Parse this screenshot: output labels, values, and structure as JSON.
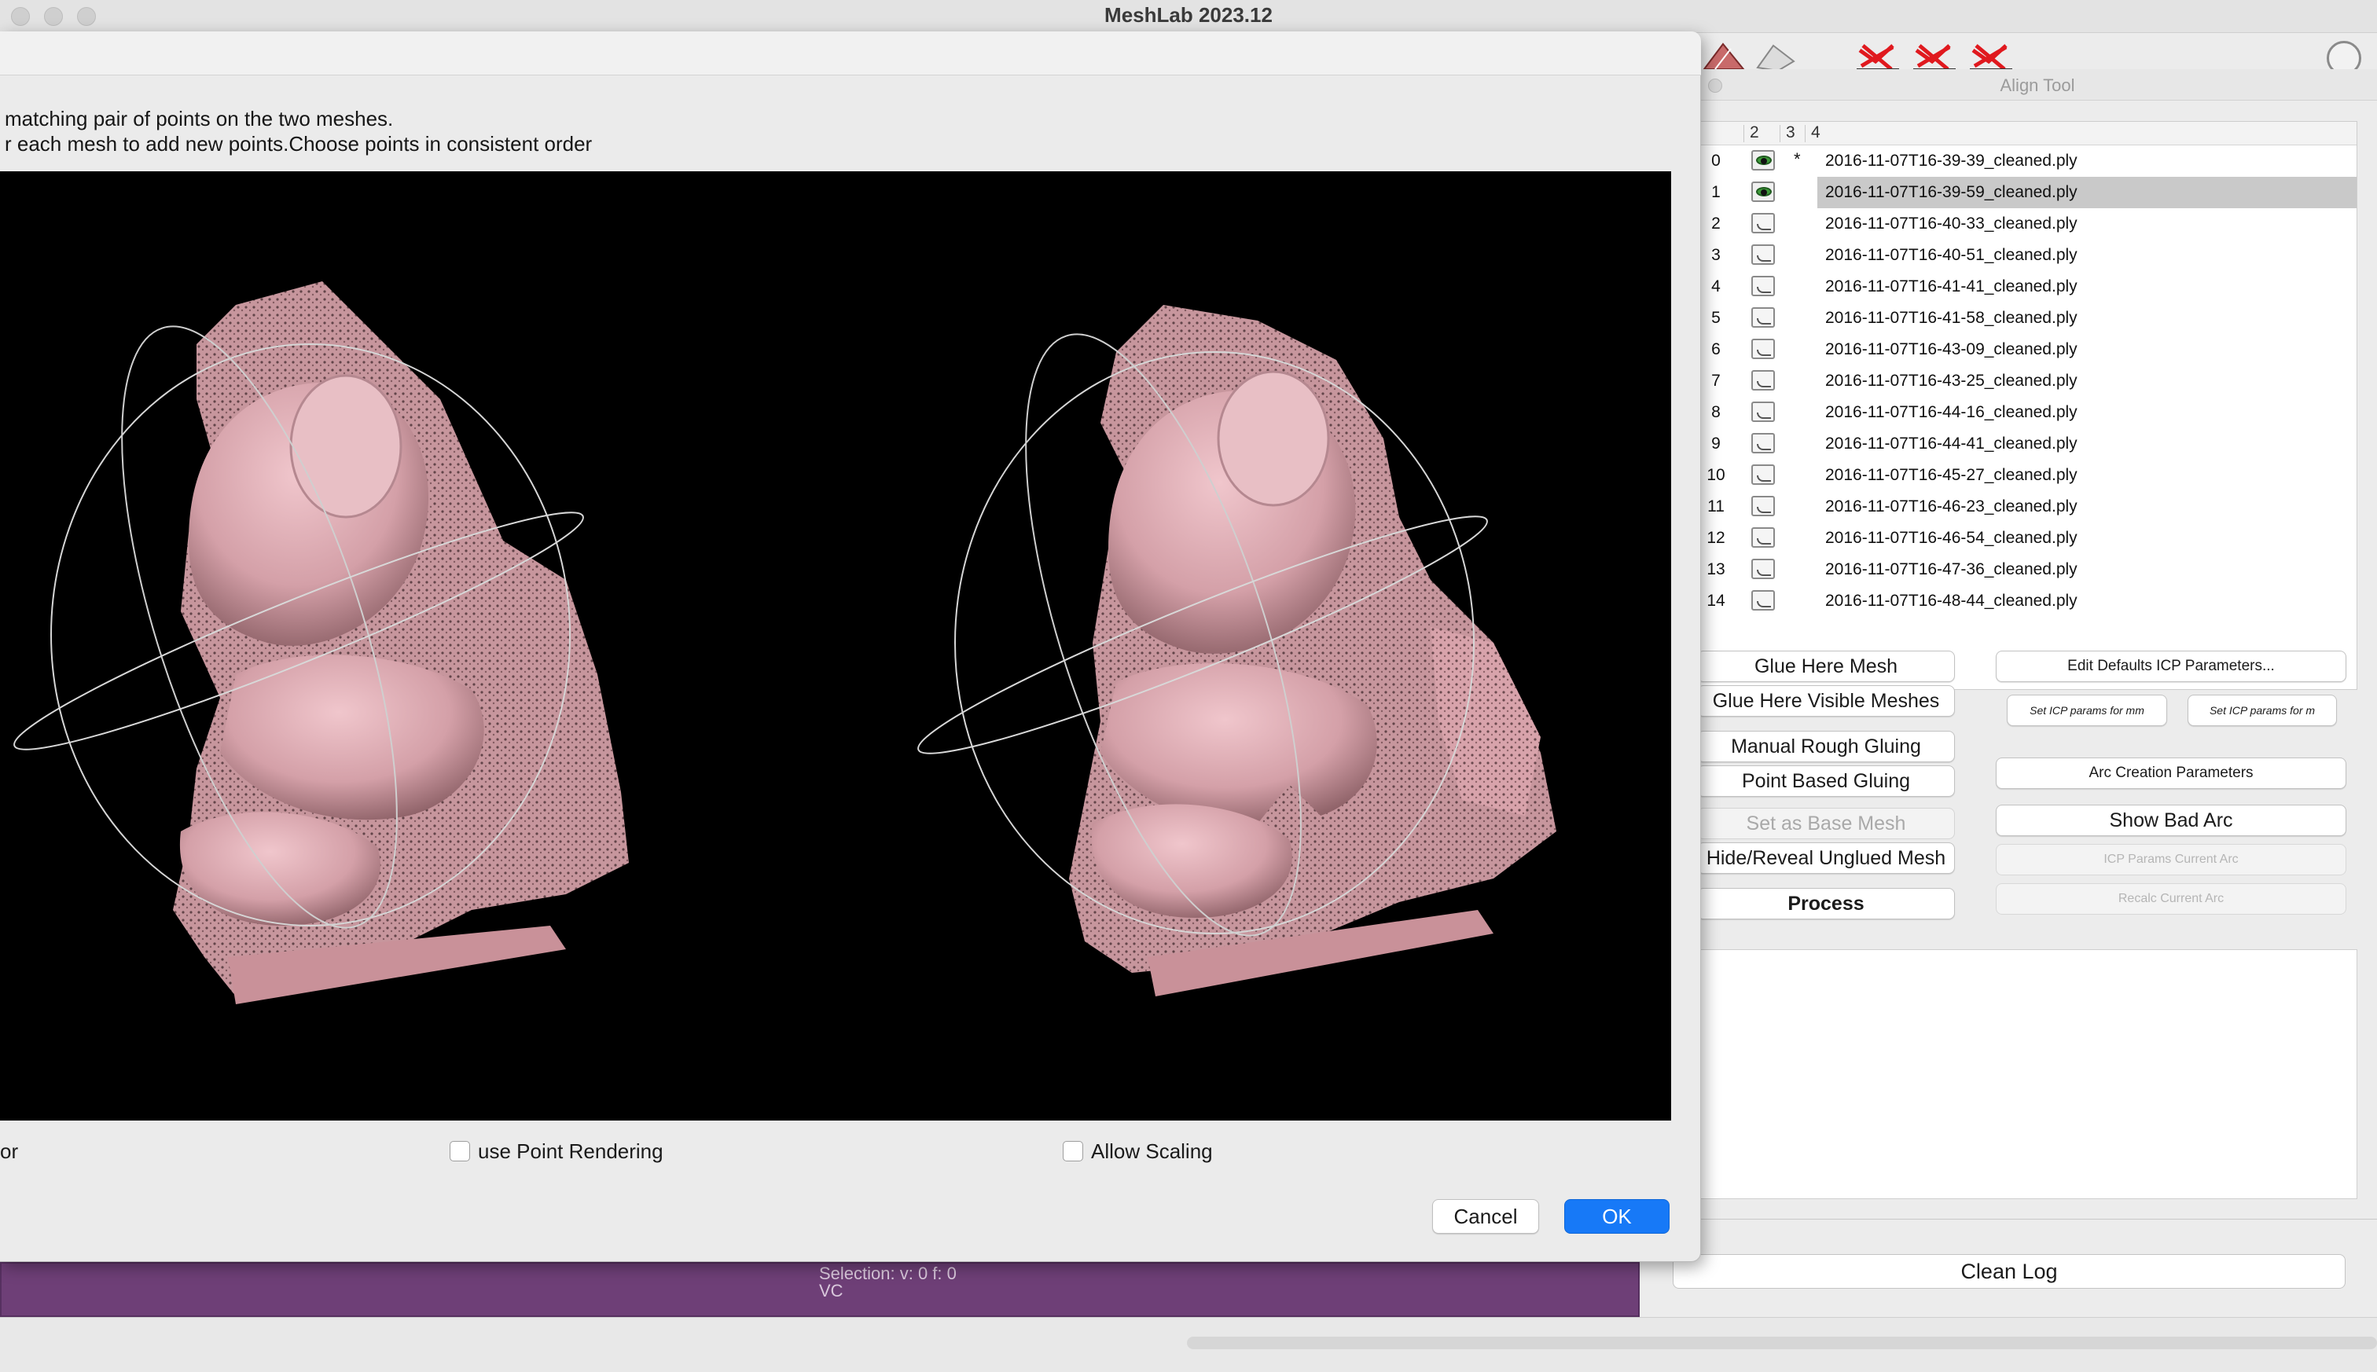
{
  "app": {
    "title": "MeshLab 2023.12"
  },
  "dialog": {
    "instructions": [
      " matching pair of points on the two meshes.",
      "r each mesh to add new points.Choose points in consistent order"
    ],
    "options": {
      "partial_label": "or",
      "point_rendering_label": "use Point Rendering",
      "allow_scaling_label": "Allow Scaling"
    },
    "cancel_label": "Cancel",
    "ok_label": "OK"
  },
  "align_tool": {
    "title": "Align Tool",
    "columns": [
      "2",
      "3",
      "4"
    ],
    "meshes": [
      {
        "id": "0",
        "visible": true,
        "base": "*",
        "name": "2016-11-07T16-39-39_cleaned.ply",
        "selected": false
      },
      {
        "id": "1",
        "visible": true,
        "base": "",
        "name": "2016-11-07T16-39-59_cleaned.ply",
        "selected": true
      },
      {
        "id": "2",
        "visible": false,
        "base": "",
        "name": "2016-11-07T16-40-33_cleaned.ply",
        "selected": false
      },
      {
        "id": "3",
        "visible": false,
        "base": "",
        "name": "2016-11-07T16-40-51_cleaned.ply",
        "selected": false
      },
      {
        "id": "4",
        "visible": false,
        "base": "",
        "name": "2016-11-07T16-41-41_cleaned.ply",
        "selected": false
      },
      {
        "id": "5",
        "visible": false,
        "base": "",
        "name": "2016-11-07T16-41-58_cleaned.ply",
        "selected": false
      },
      {
        "id": "6",
        "visible": false,
        "base": "",
        "name": "2016-11-07T16-43-09_cleaned.ply",
        "selected": false
      },
      {
        "id": "7",
        "visible": false,
        "base": "",
        "name": "2016-11-07T16-43-25_cleaned.ply",
        "selected": false
      },
      {
        "id": "8",
        "visible": false,
        "base": "",
        "name": "2016-11-07T16-44-16_cleaned.ply",
        "selected": false
      },
      {
        "id": "9",
        "visible": false,
        "base": "",
        "name": "2016-11-07T16-44-41_cleaned.ply",
        "selected": false
      },
      {
        "id": "10",
        "visible": false,
        "base": "",
        "name": "2016-11-07T16-45-27_cleaned.ply",
        "selected": false
      },
      {
        "id": "11",
        "visible": false,
        "base": "",
        "name": "2016-11-07T16-46-23_cleaned.ply",
        "selected": false
      },
      {
        "id": "12",
        "visible": false,
        "base": "",
        "name": "2016-11-07T16-46-54_cleaned.ply",
        "selected": false
      },
      {
        "id": "13",
        "visible": false,
        "base": "",
        "name": "2016-11-07T16-47-36_cleaned.ply",
        "selected": false
      },
      {
        "id": "14",
        "visible": false,
        "base": "",
        "name": "2016-11-07T16-48-44_cleaned.ply",
        "selected": false
      }
    ],
    "buttons": {
      "glue_here_mesh": "Glue Here Mesh",
      "glue_here_visible": "Glue Here Visible Meshes",
      "manual_rough_gluing": "Manual Rough Gluing",
      "point_based_gluing": "Point Based Gluing",
      "set_as_base_mesh": "Set as Base Mesh",
      "hide_reveal_unglued": "Hide/Reveal Unglued Mesh",
      "process": "Process",
      "edit_defaults_icp": "Edit Defaults ICP Parameters...",
      "set_icp_mm": "Set ICP params for mm",
      "set_icp_m": "Set ICP params for m",
      "arc_creation_params": "Arc Creation Parameters",
      "show_bad_arc": "Show Bad Arc",
      "icp_params_current_arc": "ICP Params Current Arc",
      "recalc_current_arc": "Recalc Current Arc"
    },
    "clean_log": "Clean Log"
  },
  "status": {
    "selection": "Selection: v: 0 f: 0",
    "vc": "VC"
  },
  "colors": {
    "mesh_pink": "#d9a6ae",
    "ok_blue": "#1779f7",
    "status_purple": "#6e3f77"
  }
}
